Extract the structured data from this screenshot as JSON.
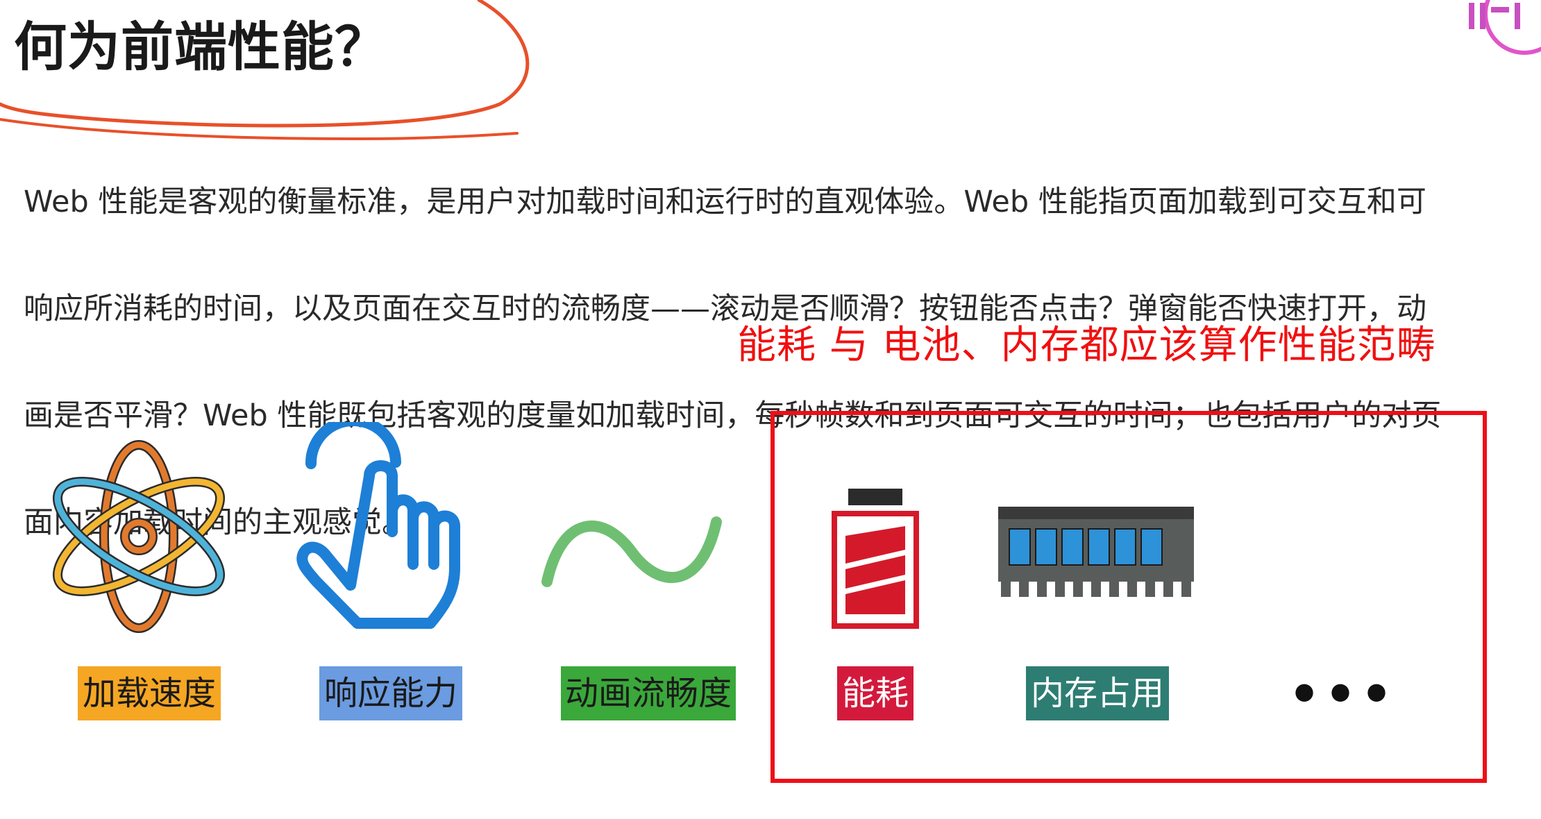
{
  "title": "何为前端性能？",
  "paragraph": {
    "line1": "Web 性能是客观的衡量标准，是用户对加载时间和运行时的直观体验。Web 性能指页面加载到可交互和可",
    "line2": "响应所消耗的时间，以及页面在交互时的流畅度——滚动是否顺滑？按钮能否点击？弹窗能否快速打开，动",
    "line3": "画是否平滑？Web 性能既包括客观的度量如加载时间，每秒帧数和到页面可交互的时间；也包括用户的对页",
    "line4": "面内容加载时间的主观感觉。"
  },
  "note": "能耗 与 电池、内存都应该算作性能范畴",
  "categories": [
    {
      "label": "加载速度",
      "icon": "atom-icon",
      "color": "#f5a623"
    },
    {
      "label": "响应能力",
      "icon": "pointing-hand-icon",
      "color": "#6b9be0"
    },
    {
      "label": "动画流畅度",
      "icon": "wave-icon",
      "color": "#3aa83a"
    },
    {
      "label": "能耗",
      "icon": "battery-icon",
      "color": "#d41a3c"
    },
    {
      "label": "内存占用",
      "icon": "memory-chip-icon",
      "color": "#2e7d73"
    }
  ],
  "more": "•••",
  "colors": {
    "annotation_red": "#ee0f16",
    "scribble_orange": "#e8502a"
  }
}
